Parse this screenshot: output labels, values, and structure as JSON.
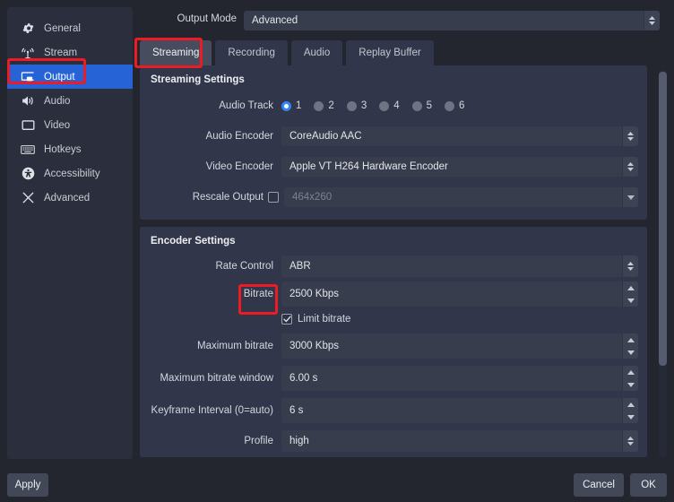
{
  "sidebar": {
    "items": [
      {
        "label": "General",
        "icon": "gear-icon",
        "selected": false
      },
      {
        "label": "Stream",
        "icon": "broadcast-icon",
        "selected": false
      },
      {
        "label": "Output",
        "icon": "output-screen-icon",
        "selected": true
      },
      {
        "label": "Audio",
        "icon": "speaker-icon",
        "selected": false
      },
      {
        "label": "Video",
        "icon": "monitor-icon",
        "selected": false
      },
      {
        "label": "Hotkeys",
        "icon": "keyboard-icon",
        "selected": false
      },
      {
        "label": "Accessibility",
        "icon": "accessibility-icon",
        "selected": false
      },
      {
        "label": "Advanced",
        "icon": "tools-icon",
        "selected": false
      }
    ]
  },
  "output_mode": {
    "label": "Output Mode",
    "value": "Advanced"
  },
  "tabs": [
    {
      "label": "Streaming",
      "active": true
    },
    {
      "label": "Recording",
      "active": false
    },
    {
      "label": "Audio",
      "active": false
    },
    {
      "label": "Replay Buffer",
      "active": false
    }
  ],
  "streaming_settings": {
    "title": "Streaming Settings",
    "audio_track": {
      "label": "Audio Track",
      "options": [
        "1",
        "2",
        "3",
        "4",
        "5",
        "6"
      ],
      "selected": "1"
    },
    "audio_encoder": {
      "label": "Audio Encoder",
      "value": "CoreAudio AAC"
    },
    "video_encoder": {
      "label": "Video Encoder",
      "value": "Apple VT H264 Hardware Encoder"
    },
    "rescale_output": {
      "label": "Rescale Output",
      "checked": false,
      "value": "464x260",
      "enabled": false
    }
  },
  "encoder_settings": {
    "title": "Encoder Settings",
    "rate_control": {
      "label": "Rate Control",
      "value": "ABR"
    },
    "bitrate": {
      "label": "Bitrate",
      "value": "2500 Kbps"
    },
    "limit_bitrate": {
      "label": "Limit bitrate",
      "checked": true
    },
    "maximum_bitrate": {
      "label": "Maximum bitrate",
      "value": "3000 Kbps"
    },
    "maximum_bitrate_window": {
      "label": "Maximum bitrate window",
      "value": "6.00 s"
    },
    "keyframe_interval": {
      "label": "Keyframe Interval (0=auto)",
      "value": "6 s"
    },
    "profile": {
      "label": "Profile",
      "value": "high"
    }
  },
  "footer": {
    "apply": "Apply",
    "cancel": "Cancel",
    "ok": "OK"
  },
  "colors": {
    "accent_selected": "#2563d6",
    "annotation": "#ed1c24",
    "panel": "#32364a",
    "window": "#23262f",
    "field": "#383d4d"
  }
}
